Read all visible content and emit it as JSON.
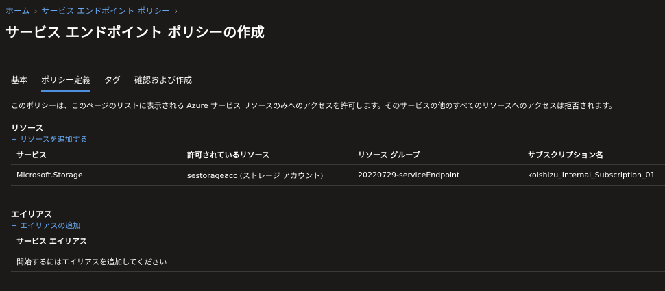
{
  "breadcrumb": {
    "home": "ホーム",
    "policy": "サービス エンドポイント ポリシー",
    "separator": ">"
  },
  "page": {
    "title": "サービス エンドポイント ポリシーの作成",
    "more": "..."
  },
  "tabs": [
    {
      "label": "基本",
      "active": false
    },
    {
      "label": "ポリシー定義",
      "active": true
    },
    {
      "label": "タグ",
      "active": false
    },
    {
      "label": "確認および作成",
      "active": false
    }
  ],
  "description": "このポリシーは、このページのリストに表示される Azure サービス リソースのみへのアクセスを許可します。そのサービスの他のすべてのリソースへのアクセスは拒否されます。",
  "resources": {
    "title": "リソース",
    "add_link": "リソースを追加する",
    "columns": [
      "サービス",
      "許可されているリソース",
      "リソース グループ",
      "サブスクリプション名"
    ],
    "rows": [
      [
        "Microsoft.Storage",
        "sestorageacc (ストレージ アカウント)",
        "20220729-serviceEndpoint",
        "koishizu_Internal_Subscription_01"
      ]
    ]
  },
  "aliases": {
    "title": "エイリアス",
    "add_link": "エイリアスの追加",
    "column": "サービス エイリアス",
    "empty": "開始するにはエイリアスを追加してください"
  },
  "icons": {
    "plus": "plus-icon",
    "chevron": "chevron-right-icon",
    "more": "more-icon"
  },
  "colors": {
    "background": "#1b1a19",
    "link": "#69a8f0",
    "accent": "#4f8fe0",
    "divider": "#3b3a39"
  }
}
